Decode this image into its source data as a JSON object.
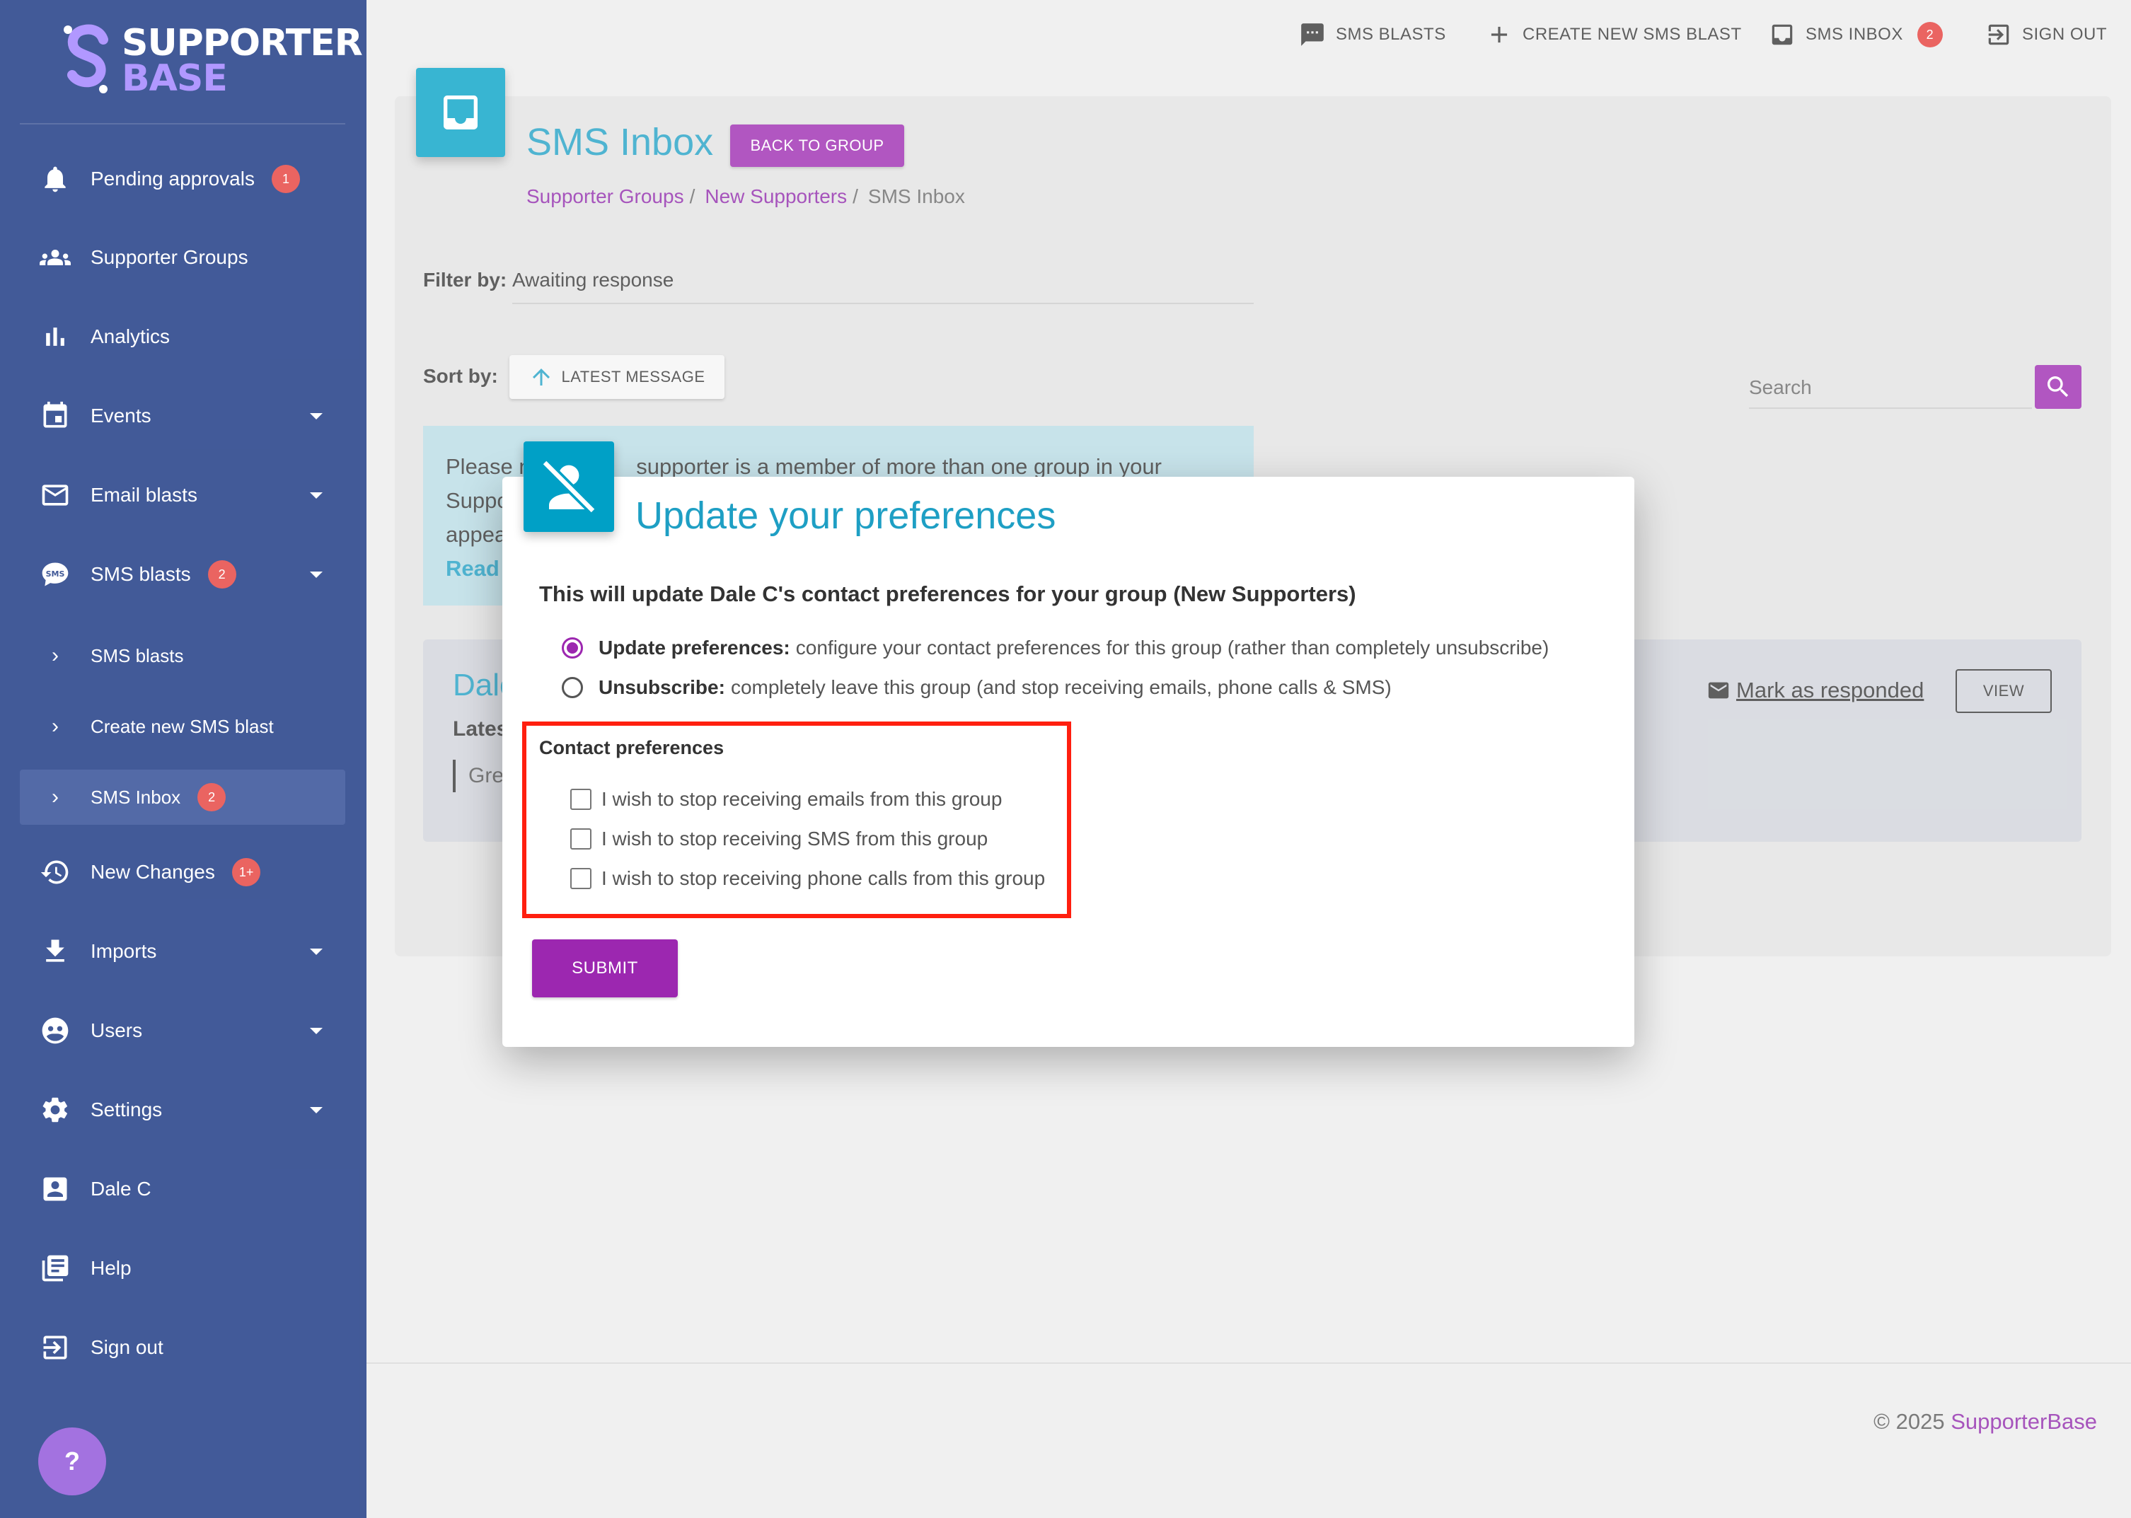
{
  "app": {
    "logo_line1": "SUPPORTER",
    "logo_line2": "BASE"
  },
  "sidebar": {
    "items": [
      {
        "label": "Pending approvals",
        "icon": "bell-icon",
        "badge": "1"
      },
      {
        "label": "Supporter Groups",
        "icon": "group-icon"
      },
      {
        "label": "Analytics",
        "icon": "bar-chart-icon"
      },
      {
        "label": "Events",
        "icon": "calendar-icon"
      },
      {
        "label": "Email blasts",
        "icon": "mail-icon"
      },
      {
        "label": "SMS blasts",
        "icon": "sms-icon",
        "badge": "2"
      },
      {
        "label": "New Changes",
        "icon": "history-icon",
        "badge": "1+"
      },
      {
        "label": "Imports",
        "icon": "download-icon"
      },
      {
        "label": "Users",
        "icon": "users-icon"
      },
      {
        "label": "Settings",
        "icon": "gear-icon"
      },
      {
        "label": "Dale C",
        "icon": "account-icon"
      },
      {
        "label": "Help",
        "icon": "help-book-icon"
      },
      {
        "label": "Sign out",
        "icon": "sign-out-icon"
      }
    ],
    "sub_items": [
      {
        "label": "SMS blasts"
      },
      {
        "label": "Create new SMS blast"
      },
      {
        "label": "SMS Inbox",
        "badge": "2"
      }
    ],
    "help_button": "?"
  },
  "topnav": {
    "sms_blasts": "SMS BLASTS",
    "create_new": "CREATE NEW SMS BLAST",
    "sms_inbox": "SMS INBOX",
    "sms_inbox_badge": "2",
    "sign_out": "SIGN OUT"
  },
  "page": {
    "title": "SMS Inbox",
    "back_button": "BACK TO GROUP",
    "breadcrumb": [
      "Supporter Groups",
      "New Supporters",
      "SMS Inbox"
    ],
    "breadcrumb_sep": "/",
    "filter_label": "Filter by:",
    "filter_value": "Awaiting response",
    "sort_label": "Sort by:",
    "sort_button": "LATEST MESSAGE",
    "search_placeholder": "Search",
    "notice_line1": "Please n",
    "notice_line1b": " supporter is a member of more than one group in your",
    "notice_line2": "Suppo",
    "notice_line3": "appea",
    "notice_read": "Read",
    "message": {
      "name": "Dale",
      "latest": "Lates",
      "preview": "Gre"
    },
    "mark_responded": "Mark as responded",
    "view_button": "VIEW"
  },
  "footer": {
    "copyright": "© 2025 ",
    "brand": "SupporterBase"
  },
  "modal": {
    "title": "Update your preferences",
    "description": "This will update Dale C's contact preferences for your group (New Supporters)",
    "options": [
      {
        "label": "Update preferences:",
        "text": "configure your contact preferences for this group (rather than completely unsubscribe)",
        "checked": true
      },
      {
        "label": "Unsubscribe:",
        "text": "completely leave this group (and stop receiving emails, phone calls & SMS)",
        "checked": false
      }
    ],
    "prefs_title": "Contact preferences",
    "checks": [
      "I wish to stop receiving emails from this group",
      "I wish to stop receiving SMS from this group",
      "I wish to stop receiving phone calls from this group"
    ],
    "submit": "SUBMIT"
  },
  "colors": {
    "sidebar": "#0d2c7c",
    "accent_purple": "#9c27b0",
    "accent_cyan": "#1e9fc4",
    "badge_red": "#e53935",
    "highlight_red": "#ff1f0f"
  }
}
